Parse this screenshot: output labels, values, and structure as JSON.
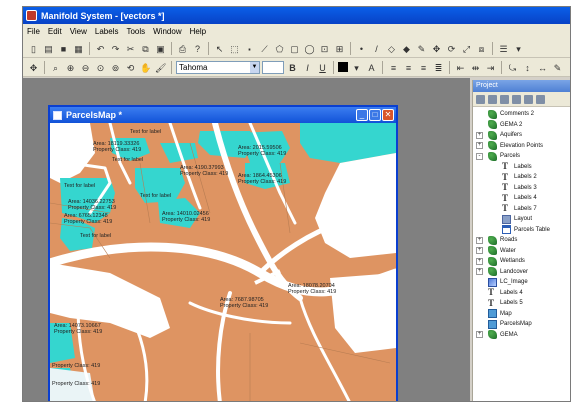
{
  "app": {
    "title": "Manifold System - [vectors *]",
    "accent": "#0a5fe8"
  },
  "menu": [
    "File",
    "Edit",
    "View",
    "Labels",
    "Tools",
    "Window",
    "Help"
  ],
  "toolbar": {
    "font_name": "Tahoma"
  },
  "map_window": {
    "title": "ParcelsMap *",
    "land_color": "#de9462",
    "parcel_highlight_color": "#35d6cf",
    "road_color": "#ffffff",
    "labels": [
      "Text for label",
      "Area: 18119.33326",
      "Property Class: 419",
      "Area: 2015.59506",
      "Property Class: 419",
      "Text for label",
      "Area: 4190.37993",
      "Property Class: 419",
      "Area: 1864.45306",
      "Property Class: 419",
      "Area: 14036.22753",
      "Property Class: 419",
      "Text for label",
      "Area: 6765.12348",
      "Property Class: 419",
      "Text for label",
      "Area: 14010.02456",
      "Property Class: 419",
      "Text for label",
      "Area: 18078.20704",
      "Property Class: 419",
      "Area: 7687.98705",
      "Property Class: 419",
      "Area: 14073.10667",
      "Property Class: 419",
      "Property Class: 419",
      "Property Class: 419"
    ]
  },
  "project": {
    "title": "Project",
    "items": [
      {
        "label": "Comments 2",
        "icon": "comments-icon",
        "depth": 0,
        "expander": ""
      },
      {
        "label": "GEMA 2",
        "icon": "layer-icon",
        "depth": 0,
        "expander": ""
      },
      {
        "label": "Aquifers",
        "icon": "layer-icon",
        "depth": 0,
        "expander": "+"
      },
      {
        "label": "Elevation Points",
        "icon": "layer-icon",
        "depth": 0,
        "expander": "+"
      },
      {
        "label": "Parcels",
        "icon": "layer-icon",
        "depth": 0,
        "expander": "-"
      },
      {
        "label": "Labels",
        "icon": "label-icon",
        "depth": 1,
        "expander": ""
      },
      {
        "label": "Labels 2",
        "icon": "label-icon",
        "depth": 1,
        "expander": ""
      },
      {
        "label": "Labels 3",
        "icon": "label-icon",
        "depth": 1,
        "expander": ""
      },
      {
        "label": "Labels 4",
        "icon": "label-icon",
        "depth": 1,
        "expander": ""
      },
      {
        "label": "Labels 7",
        "icon": "label-icon",
        "depth": 1,
        "expander": ""
      },
      {
        "label": "Layout",
        "icon": "layout-icon",
        "depth": 1,
        "expander": ""
      },
      {
        "label": "Parcels Table",
        "icon": "table-icon",
        "depth": 1,
        "expander": ""
      },
      {
        "label": "Roads",
        "icon": "layer-icon",
        "depth": 0,
        "expander": "+"
      },
      {
        "label": "Water",
        "icon": "layer-icon",
        "depth": 0,
        "expander": "+"
      },
      {
        "label": "Wetlands",
        "icon": "layer-icon",
        "depth": 0,
        "expander": "+"
      },
      {
        "label": "Landcover",
        "icon": "layer-icon",
        "depth": 0,
        "expander": "+"
      },
      {
        "label": "LC_Image",
        "icon": "image-icon",
        "depth": 0,
        "expander": ""
      },
      {
        "label": "Labels 4",
        "icon": "label-icon",
        "depth": 0,
        "expander": ""
      },
      {
        "label": "Labels 5",
        "icon": "label-icon",
        "depth": 0,
        "expander": ""
      },
      {
        "label": "Map",
        "icon": "map-icon",
        "depth": 0,
        "expander": ""
      },
      {
        "label": "ParcelsMap",
        "icon": "map-icon",
        "depth": 0,
        "expander": ""
      },
      {
        "label": "GEMA",
        "icon": "layer-icon",
        "depth": 0,
        "expander": "+"
      }
    ]
  }
}
